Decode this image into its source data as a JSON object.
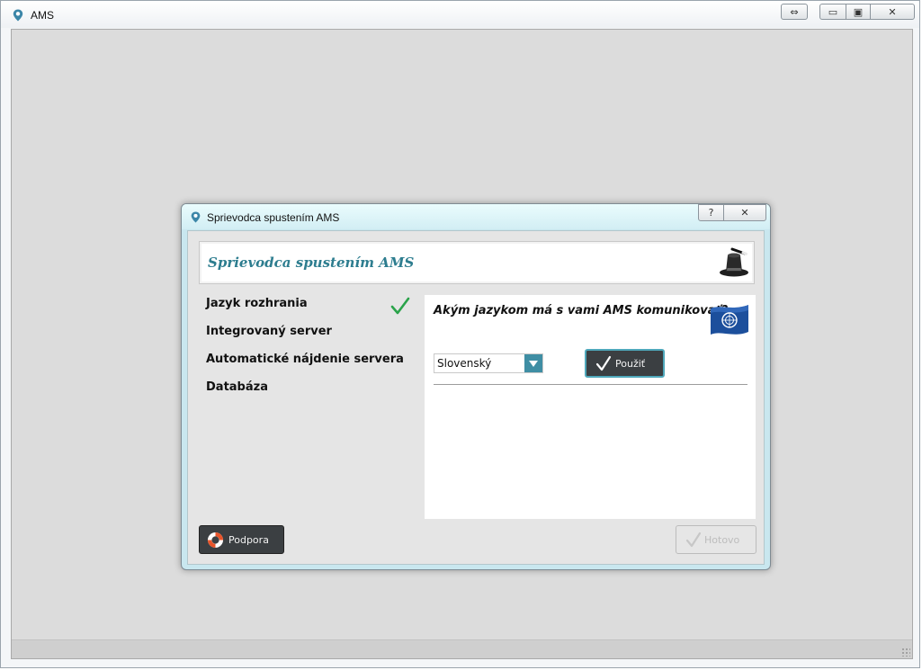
{
  "outer_window": {
    "title": "AMS",
    "icon": "location-pin-icon",
    "buttons": {
      "resize_glyph": "⇔",
      "minimize_glyph": "▭",
      "maximize_glyph": "▣",
      "close_glyph": "✕"
    }
  },
  "dialog": {
    "title": "Sprievodca spustením AMS",
    "help_glyph": "?",
    "close_glyph": "✕",
    "header_title": "Sprievodca spustením AMS",
    "header_icon": "magic-hat-icon",
    "steps": [
      {
        "label": "Jazyk rozhrania",
        "done": true
      },
      {
        "label": "Integrovaný server",
        "done": false
      },
      {
        "label": "Automatické nájdenie servera",
        "done": false
      },
      {
        "label": "Databáza",
        "done": false
      }
    ],
    "content": {
      "question": "Akým jazykom má s vami AMS komunikovať?",
      "flag_icon": "un-flag-icon",
      "language_select": {
        "value": "Slovenský"
      },
      "apply_button": "Použiť"
    },
    "support_button": "Podpora",
    "done_button": "Hotovo"
  },
  "colors": {
    "accent": "#2d7d8f",
    "select_arrow": "#3f8ea4",
    "check_green": "#2aa34a",
    "dark_button": "#3b3f42"
  }
}
